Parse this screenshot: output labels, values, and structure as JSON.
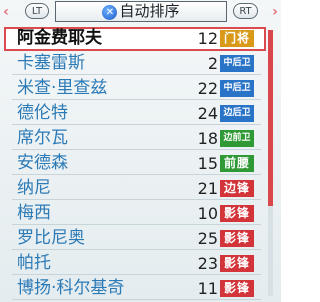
{
  "header": {
    "left_arrow": "‹",
    "right_arrow": "›",
    "lt_label": "LT",
    "rt_label": "RT",
    "x_button": "✕",
    "title": "自动排序"
  },
  "players": [
    {
      "name": "阿金费耶夫",
      "number": "12",
      "position": "门将",
      "badge_color": "#d99a1a",
      "selected": true
    },
    {
      "name": "卡塞雷斯",
      "number": "2",
      "position": "中后卫",
      "badge_color": "#2a74c7",
      "selected": false
    },
    {
      "name": "米查·里查兹",
      "number": "22",
      "position": "中后卫",
      "badge_color": "#2a74c7",
      "selected": false
    },
    {
      "name": "德伦特",
      "number": "24",
      "position": "边后卫",
      "badge_color": "#2a74c7",
      "selected": false
    },
    {
      "name": "席尔瓦",
      "number": "18",
      "position": "边前卫",
      "badge_color": "#2f9a35",
      "selected": false
    },
    {
      "name": "安德森",
      "number": "15",
      "position": "前腰",
      "badge_color": "#2f9a35",
      "selected": false
    },
    {
      "name": "纳尼",
      "number": "21",
      "position": "边锋",
      "badge_color": "#d2343a",
      "selected": false
    },
    {
      "name": "梅西",
      "number": "10",
      "position": "影锋",
      "badge_color": "#d2343a",
      "selected": false
    },
    {
      "name": "罗比尼奥",
      "number": "25",
      "position": "影锋",
      "badge_color": "#d2343a",
      "selected": false
    },
    {
      "name": "帕托",
      "number": "23",
      "position": "影锋",
      "badge_color": "#d2343a",
      "selected": false
    },
    {
      "name": "博扬·科尔基奇",
      "number": "11",
      "position": "影锋",
      "badge_color": "#d2343a",
      "selected": false
    }
  ],
  "scrollbar": {
    "thumb_color": "#d9474c",
    "position_fraction": 0.0
  }
}
